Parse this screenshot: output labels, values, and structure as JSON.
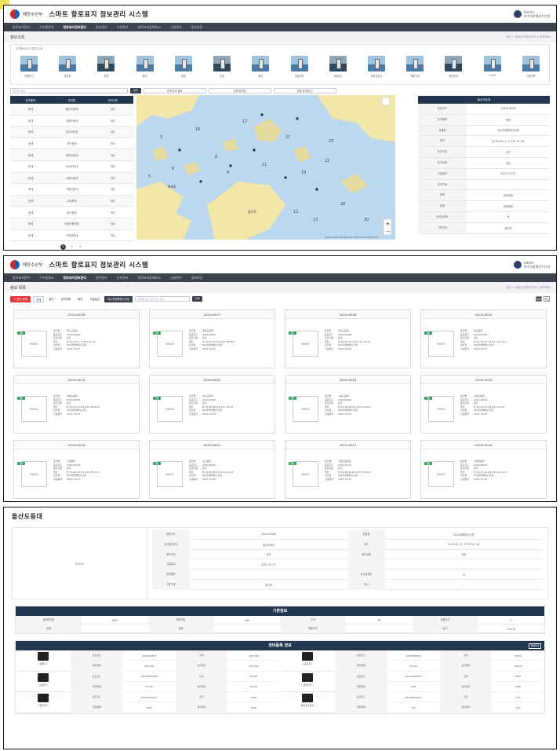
{
  "app": {
    "ministry": "해양수산부",
    "title": "스마트 항로표지 정보관리 시스템",
    "user_name": "Admin",
    "user_org": "여수지방해양수산청"
  },
  "nav": [
    "항로표지관리",
    "구조물관리",
    "항로표지정보관리",
    "장비관리",
    "유지관리",
    "항로표지장애보고",
    "시설관리",
    "정보마당"
  ],
  "screen1": {
    "page_title": "정보조회",
    "crumbs": "메인 > 항로표지정보관리 > 정보조회",
    "icons_label": "전체항로표지 통계 조회",
    "icon_types": [
      "전체보기",
      "등부표",
      "부표",
      "등대",
      "등표",
      "입표",
      "등주",
      "교량(좌)",
      "교량(우)",
      "조류신호소",
      "해양기상",
      "첨단부이",
      "V-AIS",
      "자동관측"
    ],
    "search_placeholder": "표지명 검색",
    "search_btn": "검색",
    "tabs": [
      "전체 검색 결과",
      "전체 표지명",
      "전체 표지명(3)"
    ],
    "table_headers": [
      "표지종류",
      "표지명",
      "관리기관"
    ],
    "rows": [
      [
        "등대",
        "돌산도등대",
        "여수"
      ],
      [
        "등대",
        "오동도등대",
        "여수"
      ],
      [
        "등대",
        "금오도등대",
        "여수"
      ],
      [
        "등대",
        "개도등대",
        "여수"
      ],
      [
        "등대",
        "대경도등대",
        "여수"
      ],
      [
        "등대",
        "녹산도등대",
        "여수"
      ],
      [
        "등대",
        "시동도등대",
        "여수"
      ],
      [
        "등대",
        "구봉산등대",
        "여수"
      ],
      [
        "등대",
        "고리등대",
        "여수"
      ],
      [
        "등대",
        "남도등대",
        "여수"
      ],
      [
        "등대",
        "가끔도등부표",
        "여수"
      ],
      [
        "등대",
        "간여암등대",
        "여수"
      ]
    ],
    "pages": [
      "1",
      "2",
      "3"
    ],
    "detail_header": "돌산도등대",
    "detail": [
      [
        "표준코드",
        "2021LH026"
      ],
      [
        "표지종류",
        "등대"
      ],
      [
        "관할청",
        "여수지방해양수산청"
      ],
      [
        "위치",
        "N 34-42-11, E 127-47-18"
      ],
      [
        "표지구분",
        "유인"
      ],
      [
        "표지상태",
        "정상"
      ],
      [
        "신설일자",
        "2021-10-27"
      ],
      [
        "표지기능",
        ""
      ],
      [
        "위탁",
        "정비업체"
      ],
      [
        "등질",
        "정비업체"
      ],
      [
        "공사설계자",
        "N"
      ],
      [
        "기준구분",
        "정구역"
      ]
    ],
    "map_labels": {
      "scale": "Keyboard shortcuts   Map data ©2021  10 km   Terms of Use",
      "place_a": "화태도",
      "place_b": "돌산도"
    }
  },
  "screen2": {
    "page_title": "정보 목록",
    "crumbs": "메인 > 항로표지정보관리 > 정보목록",
    "add_btn": "+ 표지 등록",
    "filters": [
      "전체",
      "설치",
      "설비개정",
      "폐지",
      "기술점검"
    ],
    "dropdown": "여수지방해양수산청",
    "search_placeholder": "표지명 또는 표지코드 검색",
    "search_btn": "검색",
    "view": [
      "목록",
      "지도"
    ],
    "cards": [
      {
        "code": "2021LH026",
        "name": "돌산도등대",
        "std": "2021LH026",
        "type": "유인",
        "pos": "N 34-42-11, E 127-47-18",
        "org": "여수지방해양수산청",
        "date": "2021-10-27"
      },
      {
        "code": "2021LH027",
        "name": "백야도등대",
        "std": "2021LH027",
        "type": "유인",
        "pos": "N 34-29-18.9,E 127-38-58.1",
        "org": "여수지방해양수산청",
        "date": "2021-10-27"
      },
      {
        "code": "2021LH028",
        "name": "금오도등대",
        "std": "2021LH028",
        "type": "유인",
        "pos": "N 34-26-28.79,E 127-42-16",
        "org": "여수지방해양수산청",
        "date": "2021-10-27"
      },
      {
        "code": "2021LH024",
        "name": "개도등대",
        "std": "2021LH024",
        "type": "유인",
        "pos": "N 34-46-10.5,E 127-34-33.7",
        "org": "여수지방해양수산청",
        "date": "2021-10-27"
      },
      {
        "code": "2021LH023",
        "name": "대경도등대",
        "std": "2021LH023",
        "type": "유인",
        "pos": "N 34-44-18.5,E 127-39-50.9",
        "org": "여수지방해양수산청",
        "date": "2021-10-27"
      },
      {
        "code": "2021LH022",
        "name": "녹산도등대",
        "std": "2021LH022",
        "type": "유인",
        "pos": "N 34-28-06.9,E 127-30-43",
        "org": "여수지방해양수산청",
        "date": "2021-10-27"
      },
      {
        "code": "2021LH020",
        "name": "시동도등대",
        "std": "2021LH020",
        "type": "유인",
        "pos": "N 34-39-36.9,E 127-30-59.5",
        "org": "여수지방해양수산청",
        "date": "2021-10-27"
      },
      {
        "code": "2021LH019",
        "name": "구봉산등대",
        "std": "2021LH019",
        "type": "유인",
        "pos": "N 34-36-10.6,E 127-35-44",
        "org": "여수지방해양수산청",
        "date": "2021-10-27"
      },
      {
        "code": "2021LH018",
        "name": "고리등대",
        "std": "2021LH018",
        "type": "유인",
        "pos": "N 34-42-27.8,E 127-38-43.1",
        "org": "여수지방해양수산청",
        "date": "2021-10-27"
      },
      {
        "code": "2021LH021",
        "name": "남도등대",
        "std": "2021LH021",
        "type": "유인",
        "pos": "N 34-45-06.3,E 127-32-49",
        "org": "여수지방해양수산청",
        "date": "2021-10-27"
      },
      {
        "code": "2021LH017",
        "name": "가끔도등부표",
        "std": "2021LH017",
        "type": "유인",
        "pos": "N 34-38-46.5,E 127-55-39.6",
        "org": "여수지방해양수산청",
        "date": "2021-10-27"
      },
      {
        "code": "2021LH016",
        "name": "간여암등대",
        "std": "2021LH016",
        "type": "유인",
        "pos": "N 34-17-16.0,E 127-13-16.0",
        "org": "여수지방해양수산청",
        "date": "2021-10-27"
      }
    ],
    "card_keys": [
      "표지명",
      "표준코드",
      "표지구분",
      "위치",
      "관할청",
      "신설일자"
    ],
    "card_badge": "설치",
    "card_img": "IMAGE",
    "pages": [
      "1",
      "2"
    ]
  },
  "screen3": {
    "title": "돌산도등대",
    "image": "IMAGE",
    "top_grid": [
      [
        "표준코드",
        "2021LH026",
        "관할청",
        "여수지방해양수산청"
      ],
      [
        "표지명(표지)",
        "돌산도등대",
        "위치",
        "N 34-42-11, E 127-47-18"
      ],
      [
        "표지구분",
        "유인",
        "표지상태",
        "정상"
      ],
      [
        "신설일자",
        "2021-10-27",
        "-",
        "-"
      ],
      [
        "표지원도",
        "-",
        "공사설계자",
        "N"
      ],
      [
        "기준구분",
        "정구역",
        "비고",
        "-"
      ]
    ],
    "basic_title": "기본정보",
    "basic": [
      [
        "등대표번호",
        "2967",
        "해도번호",
        "180",
        "도색",
        "백",
        "등화유무",
        "Y"
      ],
      [
        "등질",
        "-",
        "등광",
        "-",
        "광달거리",
        "-",
        "등고",
        "0 W 0s"
      ]
    ],
    "equip_title": "장비등록 정보",
    "equip_btn": "장비추가",
    "equipment": [
      {
        "name": "( 등명기 )",
        "r1": [
          "표준코드",
          "2021LTE407",
          "규격",
          "LED-200"
        ],
        "r2": [
          "제작업체",
          "LED-200",
          "설치일자",
          "LED-200"
        ]
      },
      {
        "name": "( 축전지 )",
        "r1": [
          "표준코드",
          "2021BTE020",
          "규격",
          "ES100"
        ],
        "r2": [
          "제작업체",
          "ES100",
          "설치일자",
          "ES100"
        ]
      },
      {
        "name": "( 축전지 )",
        "r1": [
          "표준코드",
          "2021BTE0008",
          "규격",
          "ES100"
        ],
        "r2": [
          "제작업체",
          "ES100",
          "설치일자",
          "ES100"
        ]
      },
      {
        "name": "( 태양전지 )",
        "r1": [
          "표준코드",
          "2021SCE0016",
          "규격",
          "80W"
        ],
        "r2": [
          "제작업체",
          "80W",
          "설치일자",
          "80W"
        ]
      },
      {
        "name": "( 태양전지 )",
        "r1": [
          "표준코드",
          "2021SCE0017",
          "규격",
          "80W"
        ],
        "r2": [
          "제작업체",
          "80W",
          "설치일자",
          "80W"
        ]
      },
      {
        "name": "( 충방전조절기 )",
        "r1": [
          "표준코드",
          "2021BCE0017",
          "규격",
          "15A"
        ],
        "r2": [
          "제작업체",
          "15A",
          "설치일자",
          "15A"
        ]
      }
    ]
  },
  "colors": {
    "header_navy": "#23364f",
    "nav_bar": "#3d4450",
    "badge_green": "#2e9c5a",
    "add_red": "#e53935",
    "map_sea": "#bfd9ef",
    "map_land": "#f2e6a8"
  }
}
